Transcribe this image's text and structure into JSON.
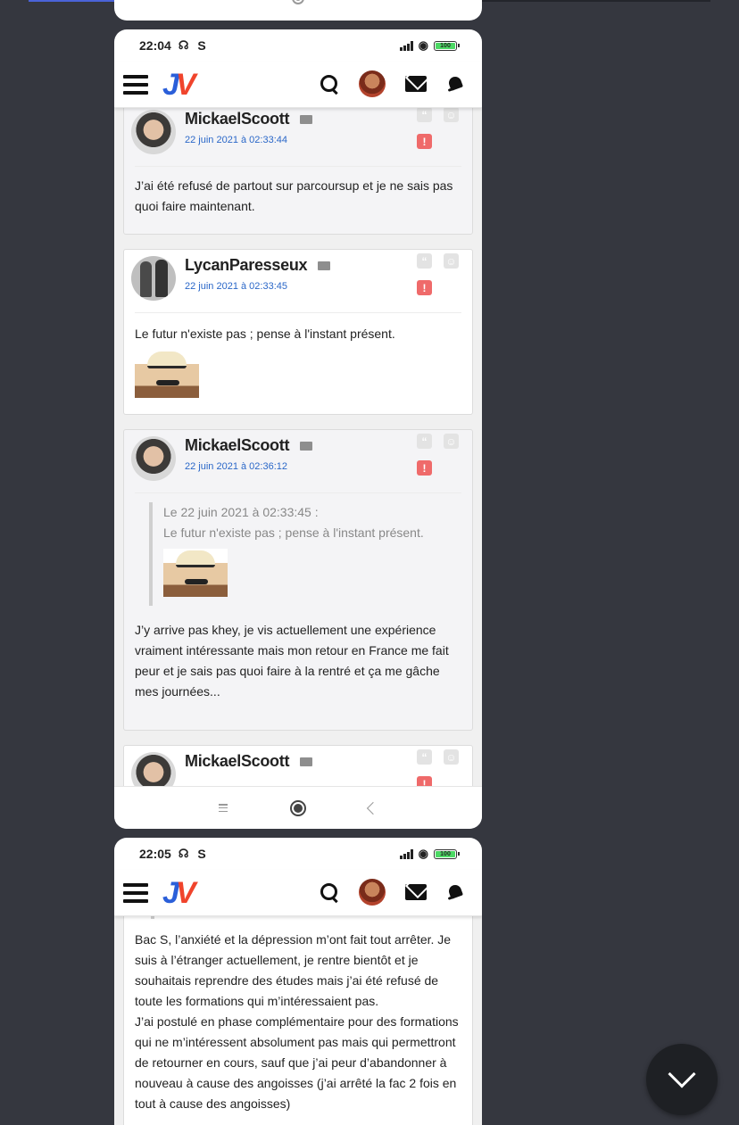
{
  "status_1": {
    "time": "22:04",
    "carrier": "S",
    "battery": "100"
  },
  "status_2": {
    "time": "22:05",
    "carrier": "S",
    "battery": "100"
  },
  "app": {
    "logo_j": "J",
    "logo_v": "V"
  },
  "posts": [
    {
      "author": "MickaelScoott",
      "date": "22 juin 2021 à 02:33:44",
      "text": "J’ai été refusé de partout sur parcoursup et je ne sais pas quoi faire maintenant."
    },
    {
      "author": "LycanParesseux",
      "date": "22 juin 2021 à 02:33:45",
      "text": "Le futur n'existe pas ; pense à l'instant présent."
    },
    {
      "author": "MickaelScoott",
      "date": "22 juin 2021 à 02:36:12",
      "quote_header": "Le 22 juin 2021 à 02:33:45 :",
      "quote_text": "Le futur n'existe pas ; pense à l'instant présent.",
      "text": "J’y arrive pas khey, je vis actuellement une expérience vraiment intéressante mais mon retour en France me fait peur et je sais pas quoi faire à la rentré et ça me gâche mes journées..."
    },
    {
      "author": "MickaelScoott"
    }
  ],
  "post_screen2": {
    "text": "Bac S, l’anxiété et la dépression m’ont fait tout arrêter. Je suis à l’étranger actuellement, je rentre bientôt et je souhaitais reprendre des études mais j’ai été refusé de toute les formations qui m’intéressaient pas.\nJ’ai postulé en phase complémentaire pour des formations qui ne m’intéressent absolument pas mais qui permettront de retourner en cours, sauf que j’ai peur d’abandonner à nouveau à cause des angoisses (j’ai arrêté la fac 2 fois en tout à cause des angoisses)"
  },
  "icons": [
    "hamburger-icon",
    "search-icon",
    "avatar",
    "mail-icon",
    "notification-icon",
    "quote-icon",
    "smiley-icon",
    "report-icon",
    "private-message-icon",
    "chevron-down-icon"
  ],
  "colors": {
    "date_link": "#2a67c8",
    "report": "#ef6a6a",
    "logo_j": "#2b5fd9",
    "logo_v": "#f0442c",
    "background": "#35373f"
  }
}
